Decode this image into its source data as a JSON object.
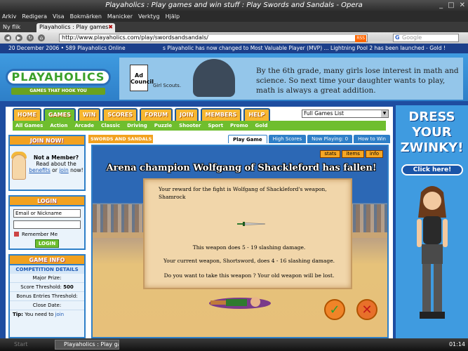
{
  "browser": {
    "window_title": "Playaholics : Play games and win stuff : Play Swords and Sandals - Opera",
    "menu": [
      "Arkiv",
      "Redigera",
      "Visa",
      "Bokmärken",
      "Manicker",
      "Verktyg",
      "Hjälp"
    ],
    "tabs": [
      {
        "label": "Ny flik"
      },
      {
        "label": "Playaholics : Play games ..."
      }
    ],
    "url": "http://www.playaholics.com/play/swordsandsandals/",
    "rss_label": "RSS",
    "search_placeholder": "Google",
    "search_engine": "G"
  },
  "ticker": {
    "date": "20 December 2006",
    "online": "589 Playaholics Online",
    "news": "s Playaholic has now changed to Most Valuable Player (MVP) ... Lightning Pool 2 has been launched - Gold !"
  },
  "logo": {
    "name": "PLAYAHOLICS",
    "tagline": "GAMES THAT HOOK YOU"
  },
  "banner_ad": {
    "sponsor1": "Ad Council",
    "sponsor2": "Girl Scouts.",
    "text": "By the 6th grade, many girls lose interest in math and science. So next time your daughter wants to play, math is always a great addition."
  },
  "nav": {
    "tabs": [
      "HOME",
      "GAMES",
      "WIN",
      "SCORES",
      "FORUM",
      "JOIN",
      "MEMBERS",
      "HELP"
    ],
    "active": "GAMES",
    "subnav": [
      "All Games",
      "Action",
      "Arcade",
      "Classic",
      "Driving",
      "Puzzle",
      "Shooter",
      "Sport",
      "Promo",
      "Gold"
    ],
    "game_select": "Full Games List"
  },
  "join_box": {
    "header": "JOIN NOW!",
    "q": "Not a Member?",
    "l1": "Read about",
    "l2": "the",
    "benefits": "benefits",
    "l3": "or",
    "join": "join",
    "l4": "now!"
  },
  "login_box": {
    "header": "LOGIN",
    "email_placeholder": "Email or Nickname",
    "remember": "Remember Me",
    "button": "LOGIN"
  },
  "game_info": {
    "header": "GAME INFO",
    "section": "COMPETITION DETAILS",
    "rows": [
      {
        "label": "Major Prize:",
        "value": ""
      },
      {
        "label": "Score Threshold:",
        "value": "500"
      },
      {
        "label": "Bonus Entries Threshold:",
        "value": ""
      },
      {
        "label": "Close Date:",
        "value": ""
      }
    ],
    "tip_label": "Tip:",
    "tip_text": "You need to",
    "tip_link": "join"
  },
  "game": {
    "title": "SWORDS AND SANDALS",
    "tabs": [
      "Play Game",
      "High Scores",
      "Now Playing: 0",
      "How to Win"
    ],
    "active_tab": "Play Game",
    "minitabs": [
      "stats",
      "items",
      "info"
    ],
    "headline": "Arena champion Wolfgang of Shackleford has fallen!",
    "reward": "Your reward for the fight is Wolfgang of Shackleford's weapon, Shamrock",
    "damage": "This weapon does 5 - 19 slashing damage.",
    "current": "Your current weapon, Shortsword, does 4 - 16 slashing damage.",
    "question": "Do you want to take this weapon ? Your old weapon will be lost.",
    "accept": "✓",
    "decline": "✕"
  },
  "right_ad": {
    "headline_1": "DRESS",
    "headline_2": "YOUR",
    "headline_3": "ZWINKY!",
    "button": "Click here!"
  },
  "taskbar": {
    "start": "Start",
    "task": "Playaholics : Play ga...",
    "clock": "01:14"
  },
  "colors": {
    "accent_orange": "#f2a11f",
    "accent_green": "#6fbe2e",
    "accent_blue": "#2e7fc8"
  }
}
